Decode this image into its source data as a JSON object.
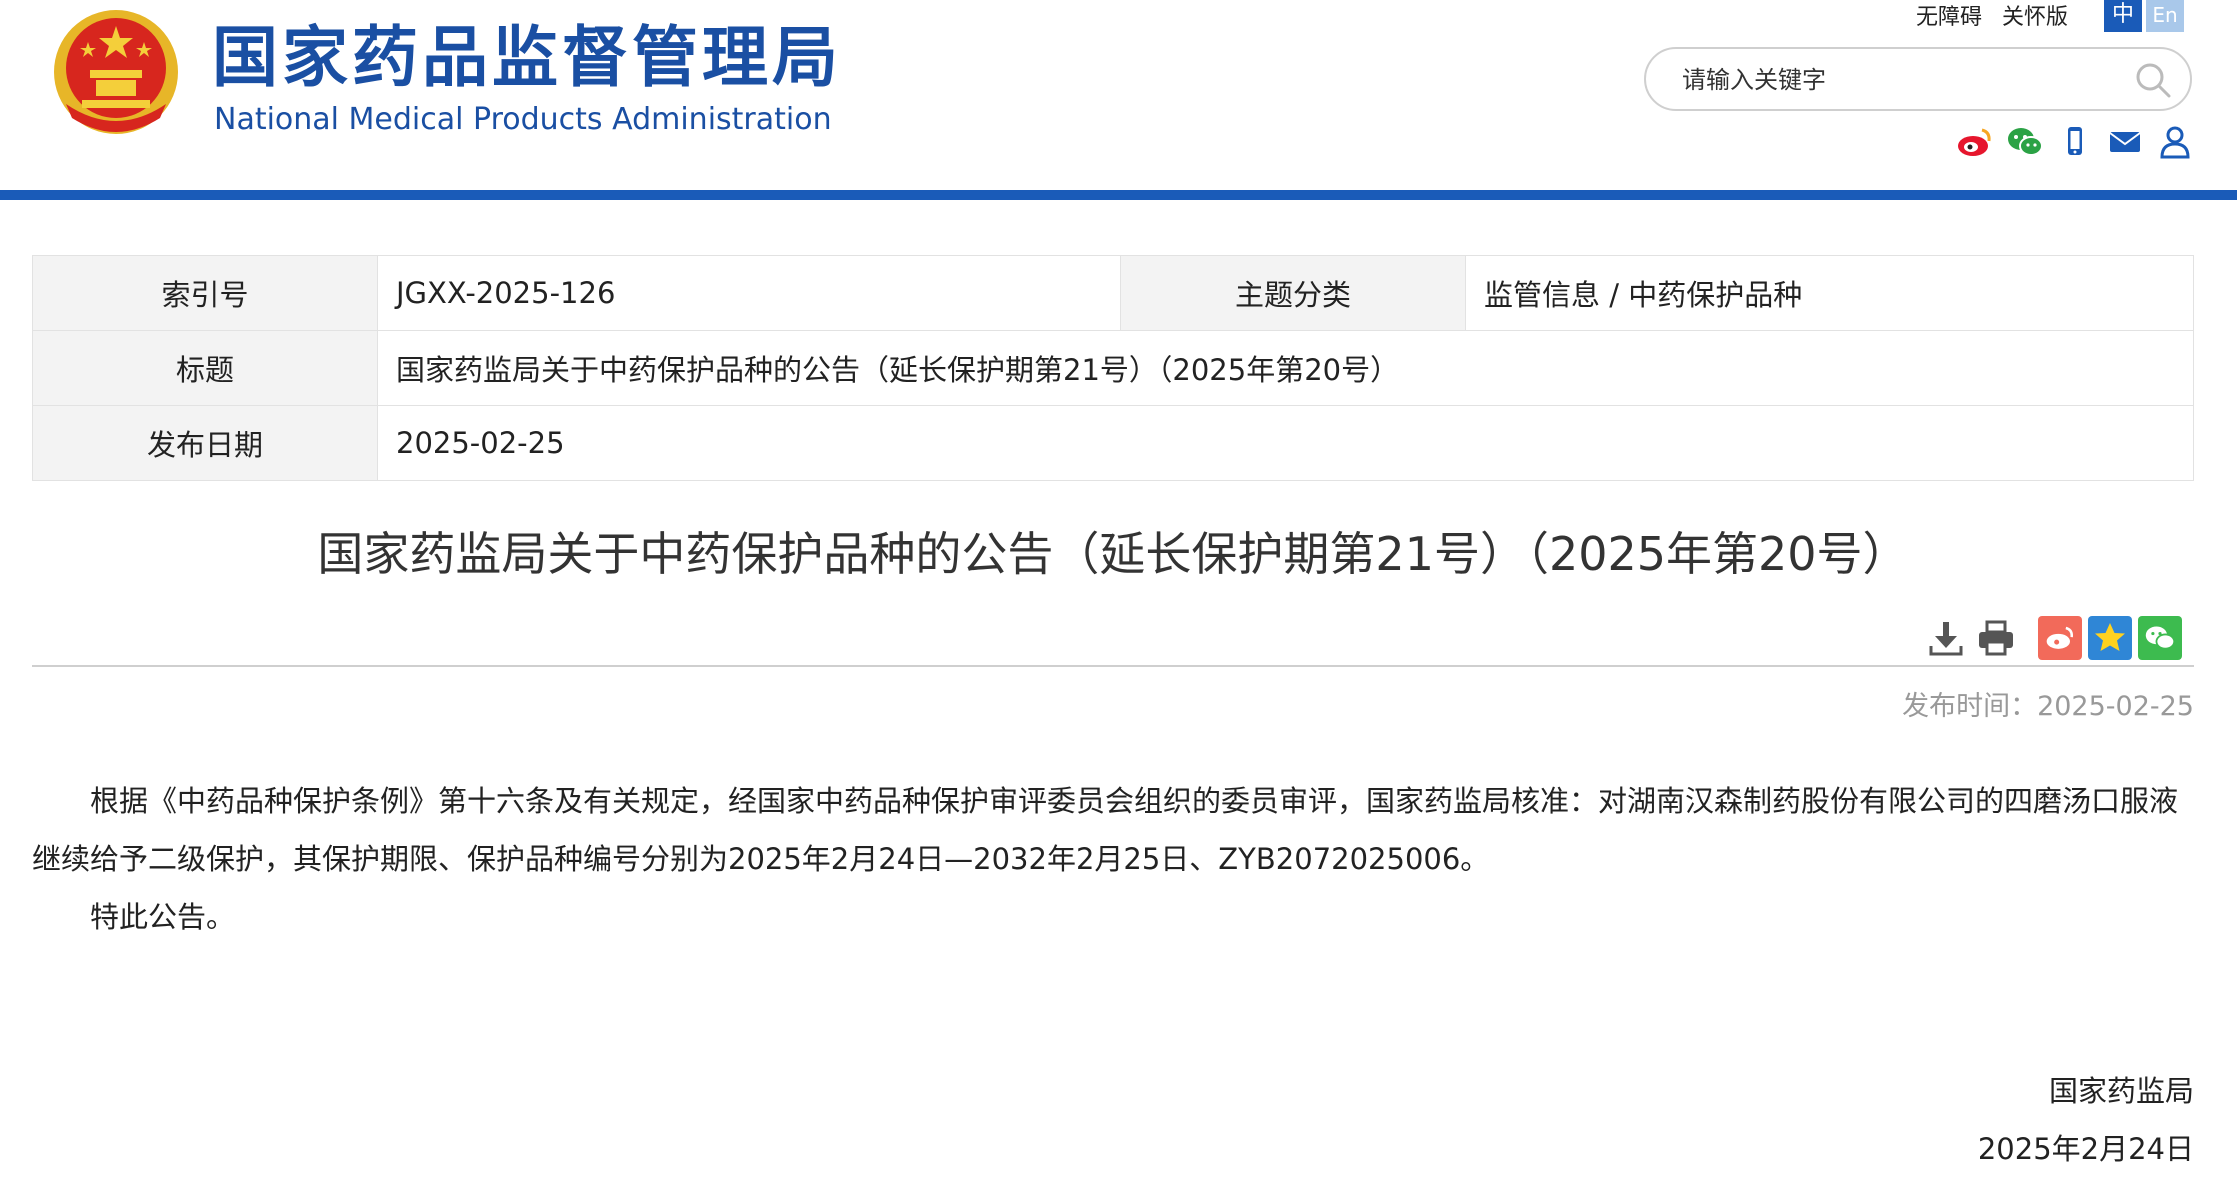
{
  "header": {
    "site_name_cn": "国家药品监督管理局",
    "site_name_en": "National Medical Products Administration",
    "top_links": [
      "无障碍",
      "关怀版"
    ],
    "lang_zh": "中",
    "lang_en": "En",
    "search_placeholder": "请输入关键字",
    "social_icons": [
      "weibo-icon",
      "wechat-icon",
      "mobile-icon",
      "mail-icon",
      "user-icon"
    ],
    "accent_color": "#1a5bb8"
  },
  "meta": {
    "index_label": "索引号",
    "index_value": "JGXX-2025-126",
    "category_label": "主题分类",
    "category_value": "监管信息 / 中药保护品种",
    "title_label": "标题",
    "title_value": "国家药监局关于中药保护品种的公告（延长保护期第21号）（2025年第20号）",
    "date_label": "发布日期",
    "date_value": "2025-02-25"
  },
  "article": {
    "title": "国家药监局关于中药保护品种的公告（延长保护期第21号）（2025年第20号）",
    "publish_label": "发布时间：",
    "publish_value": "2025-02-25",
    "paragraphs": [
      "根据《中药品种保护条例》第十六条及有关规定，经国家中药品种保护审评委员会组织的委员审评，国家药监局核准：对湖南汉森制药股份有限公司的四磨汤口服液继续给予二级保护，其保护期限、保护品种编号分别为2025年2月24日—2032年2月25日、ZYB2072025006。",
      "特此公告。"
    ],
    "signature_org": "国家药监局",
    "signature_date": "2025年2月24日"
  }
}
